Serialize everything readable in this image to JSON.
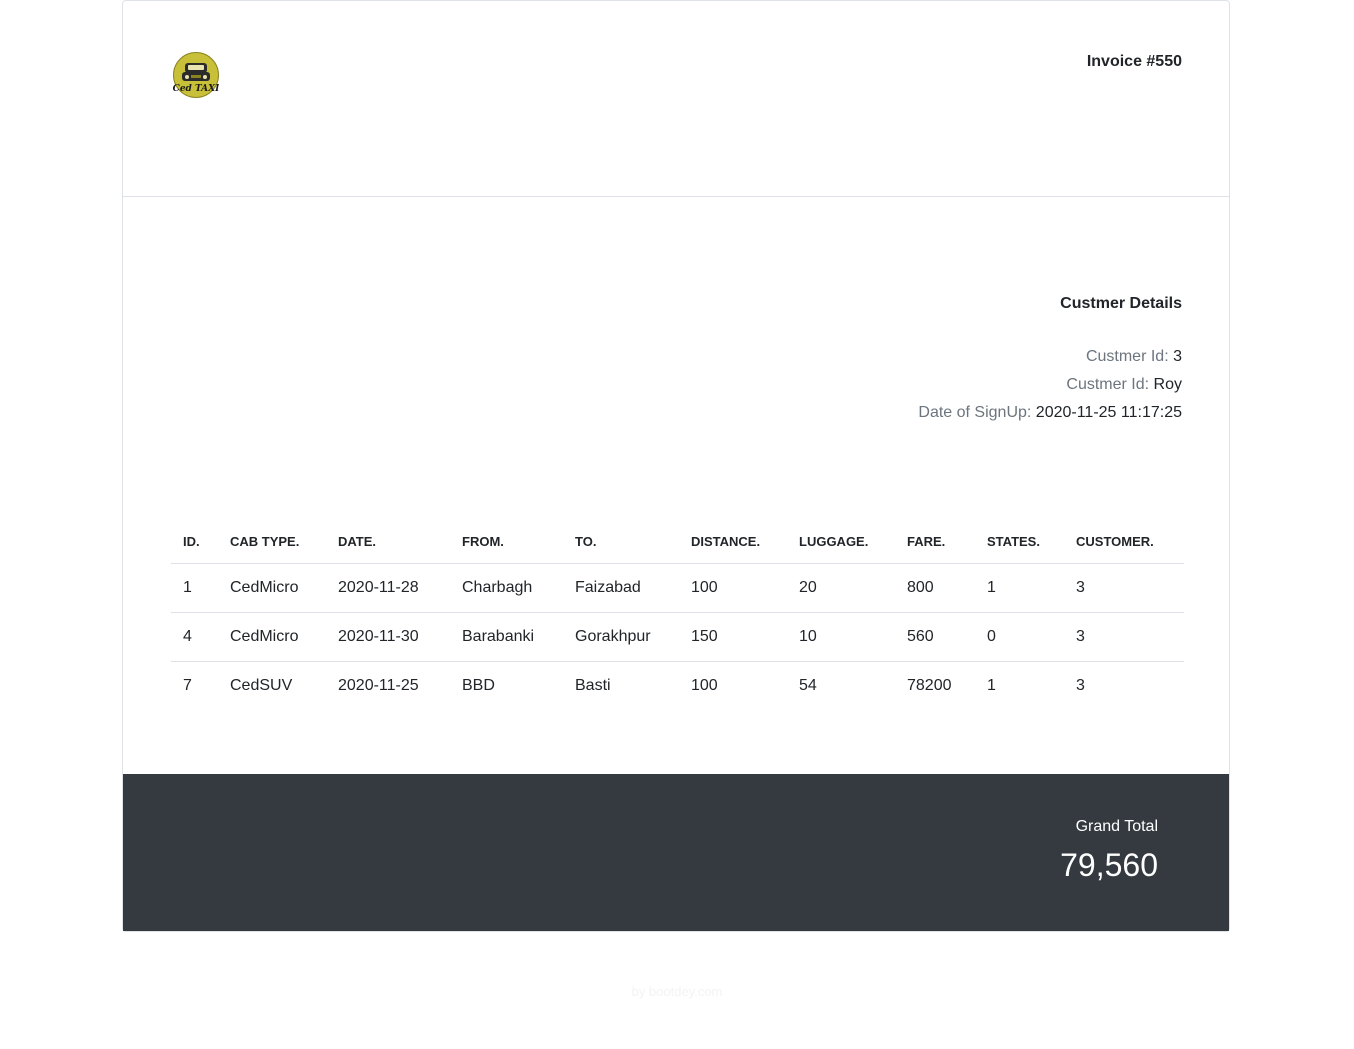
{
  "invoice": {
    "title": "Invoice #550",
    "logo_icon": "taxi-logo-icon",
    "logo_text": "Ced TAXI"
  },
  "customer": {
    "heading": "Custmer Details",
    "id_label": "Custmer Id:",
    "id_value": "3",
    "name_label": "Custmer Id:",
    "name_value": "Roy",
    "signup_label": "Date of SignUp:",
    "signup_value": "2020-11-25 11:17:25"
  },
  "table": {
    "headers": [
      "ID.",
      "CAB TYPE.",
      "DATE.",
      "FROM.",
      "TO.",
      "DISTANCE.",
      "LUGGAGE.",
      "FARE.",
      "STATES.",
      "CUSTOMER."
    ],
    "rows": [
      [
        "1",
        "CedMicro",
        "2020-11-28",
        "Charbagh",
        "Faizabad",
        "100",
        "20",
        "800",
        "1",
        "3"
      ],
      [
        "4",
        "CedMicro",
        "2020-11-30",
        "Barabanki",
        "Gorakhpur",
        "150",
        "10",
        "560",
        "0",
        "3"
      ],
      [
        "7",
        "CedSUV",
        "2020-11-25",
        "BBD",
        "Basti",
        "100",
        "54",
        "78200",
        "1",
        "3"
      ]
    ]
  },
  "summary": {
    "total_label": "Grand Total",
    "total_value": "79,560"
  },
  "credit": {
    "text": "by  bootdey.com"
  },
  "colors": {
    "footer_bg": "#343a40",
    "border": "#dee2e6",
    "muted": "#6c757d",
    "logo_yellow": "#c9c03a"
  }
}
